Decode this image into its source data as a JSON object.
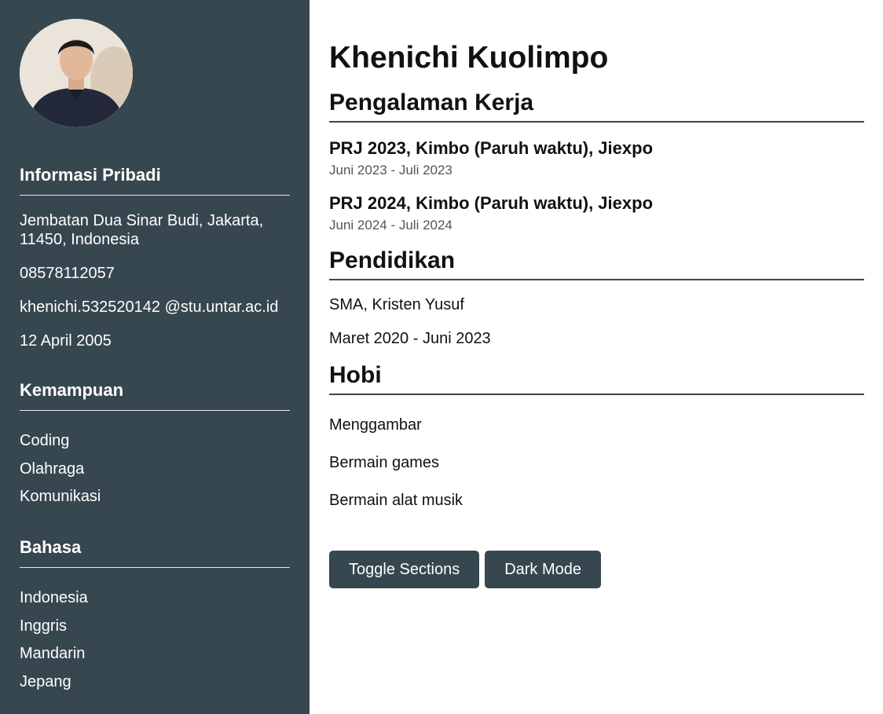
{
  "profile": {
    "name": "Khenichi Kuolimpo"
  },
  "sidebar": {
    "personal": {
      "heading": "Informasi Pribadi",
      "address": "Jembatan Dua Sinar Budi, Jakarta, 11450, Indonesia",
      "phone": "08578112057",
      "email": "khenichi.532520142 @stu.untar.ac.id",
      "birthdate": "12 April 2005"
    },
    "skills": {
      "heading": "Kemampuan",
      "items": [
        "Coding",
        "Olahraga",
        "Komunikasi"
      ]
    },
    "languages": {
      "heading": "Bahasa",
      "items": [
        "Indonesia",
        "Inggris",
        "Mandarin",
        "Jepang"
      ]
    }
  },
  "experience": {
    "heading": "Pengalaman Kerja",
    "jobs": [
      {
        "title": "PRJ 2023, Kimbo (Paruh waktu), Jiexpo",
        "dates": "Juni 2023 - Juli 2023"
      },
      {
        "title": "PRJ 2024, Kimbo (Paruh waktu), Jiexpo",
        "dates": "Juni 2024 - Juli 2024"
      }
    ]
  },
  "education": {
    "heading": "Pendidikan",
    "school": "SMA, Kristen Yusuf",
    "dates": "Maret 2020 - Juni 2023"
  },
  "hobbies": {
    "heading": "Hobi",
    "items": [
      "Menggambar",
      "Bermain games",
      "Bermain alat musik"
    ]
  },
  "actions": {
    "toggle_label": "Toggle Sections",
    "dark_label": "Dark Mode"
  },
  "colors": {
    "sidebar_bg": "#37474f",
    "button_bg": "#37474f",
    "text": "#111111"
  }
}
